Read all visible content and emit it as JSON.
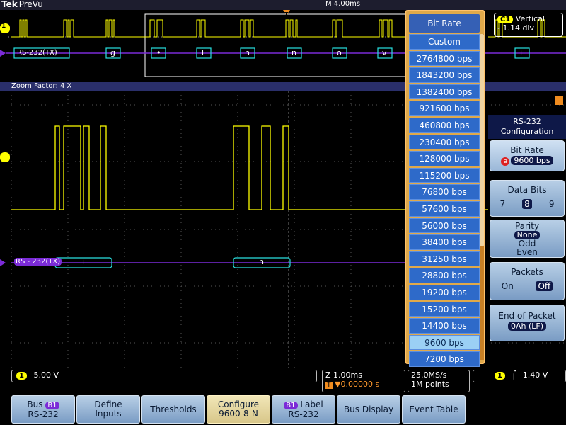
{
  "topbar": {
    "brand": "Tek",
    "mode": "PreVu",
    "time_position": "M 4.00ms"
  },
  "overview": {
    "bus_label": "RS-232(TX)",
    "decoded": [
      "g",
      "•",
      "l",
      "n",
      "n",
      "o",
      "v",
      "i"
    ],
    "vertical_box": {
      "title": "Vertical",
      "value": "- 1.14 div"
    }
  },
  "zoom": {
    "label": "Zoom Factor: 4 X"
  },
  "main": {
    "bus_label": "RS - 232(TX)",
    "decoded": [
      "i",
      "n"
    ]
  },
  "readout": {
    "ch1_scale": "5.00 V",
    "zoom_scale": "Z 1.00ms",
    "trigger_pos": "▼0.00000 s",
    "sample_rate": "25.0MS/s",
    "record_length": "1M points",
    "trigger_level": "1.40 V"
  },
  "bottom_menu": {
    "bus": {
      "line1": "Bus",
      "badge": "B1",
      "line2": "RS-232"
    },
    "define_inputs": {
      "line1": "Define",
      "line2": "Inputs"
    },
    "thresholds": "Thresholds",
    "configure": {
      "line1": "Configure",
      "line2": "9600-8-N"
    },
    "b1_label": {
      "badge": "B1",
      "line1": "Label",
      "line2": "RS-232"
    },
    "bus_display": "Bus Display",
    "event_table": "Event Table"
  },
  "bit_rate_menu": {
    "title": "Bit Rate",
    "options": [
      "Custom",
      "2764800 bps",
      "1843200 bps",
      "1382400 bps",
      "921600 bps",
      "460800 bps",
      "230400 bps",
      "128000 bps",
      "115200 bps",
      "76800 bps",
      "57600 bps",
      "56000 bps",
      "38400 bps",
      "31250 bps",
      "28800 bps",
      "19200 bps",
      "15200 bps",
      "14400 bps",
      "9600 bps",
      "7200 bps"
    ],
    "selected": "9600 bps"
  },
  "config_menu": {
    "title_line1": "RS-232",
    "title_line2": "Configuration",
    "bit_rate": {
      "label": "Bit Rate",
      "knob": "a",
      "value": "9600 bps"
    },
    "data_bits": {
      "label": "Data Bits",
      "options": [
        "7",
        "8",
        "9"
      ],
      "selected": "8"
    },
    "parity": {
      "label": "Parity",
      "options": [
        "None",
        "Odd",
        "Even"
      ],
      "selected": "None"
    },
    "packets": {
      "label": "Packets",
      "on": "On",
      "off": "Off",
      "selected": "Off"
    },
    "end_of_packet": {
      "label": "End of Packet",
      "value": "0Ah (LF)"
    }
  },
  "colors": {
    "ch1": "#ffff00",
    "bus": "#7b2bd7",
    "decode_box": "#29e0e0",
    "menu_blue": "#2e6ac9",
    "menu_orange": "#e0a94a"
  }
}
